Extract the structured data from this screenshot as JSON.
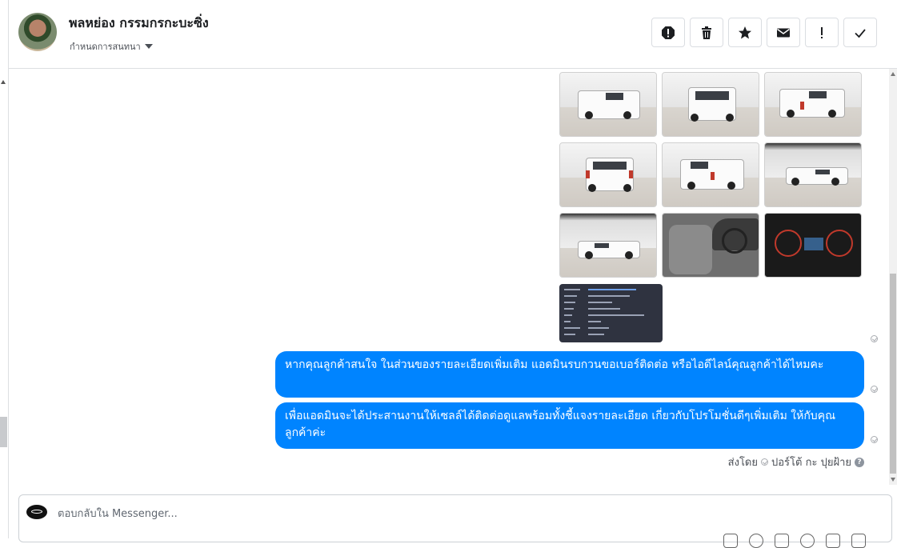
{
  "header": {
    "name": "พลหย่อง กรรมกรกะบะซิ่ง",
    "subtitle": "กำหนดการสนทนา"
  },
  "toolbar": {
    "buttons": [
      {
        "name": "spam-icon"
      },
      {
        "name": "trash-icon"
      },
      {
        "name": "star-icon"
      },
      {
        "name": "mail-icon"
      },
      {
        "name": "exclamation-icon"
      },
      {
        "name": "check-icon"
      }
    ]
  },
  "messages": [
    {
      "text": "หากคุณลูกค้าสนใจ ในส่วนของรายละเอียดเพิ่มเติม แอดมินรบกวนขอเบอร์ติดต่อ หรือไอดีไลน์คุณลูกค้าได้ไหมคะ"
    },
    {
      "text": "เพื่อแอดมินจะได้ประสานงานให้เซลล์ได้ติดต่อดูแลพร้อมทั้งชี้แจงรายละเอียด เกี่ยวกับโปรโมชั่นดีๆเพิ่มเติม ให้กับคุณลูกค้าค่ะ"
    }
  ],
  "sent_by": {
    "prefix": "ส่งโดย",
    "sender": "ปอร์โต้ กะ ปุยฝ้าย"
  },
  "composer": {
    "placeholder": "ตอบกลับใน Messenger..."
  },
  "colors": {
    "bubble": "#0084ff",
    "border": "#dddfe2"
  }
}
